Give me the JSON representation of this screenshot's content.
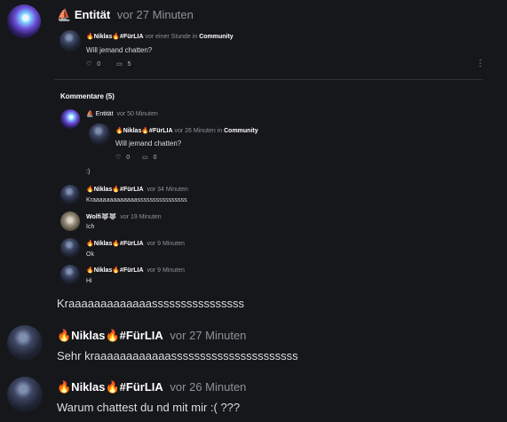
{
  "main_post": {
    "author": "Entität",
    "time": "vor 27 Minuten",
    "shared": {
      "author_prefix": "🔥Niklas🔥#FürLIA",
      "meta": "vor einer Stunde in",
      "community": "Community",
      "text": "Will jemand chatten?",
      "likes": "0",
      "comments": "5"
    }
  },
  "comments_header": "Kommentare (5)",
  "comments": [
    {
      "author": "Entität",
      "time": "vor 50 Minuten",
      "quoted": {
        "author": "🔥Niklas🔥#FürLIA",
        "meta": "vor 26 Minuten in",
        "community": "Community",
        "text": "Will jemand chatten?",
        "likes": "0",
        "comments": "0"
      },
      "text": ":)"
    },
    {
      "author": "🔥Niklas🔥#FürLIA",
      "time": "vor 34 Minuten",
      "text": "Kraaaaaaaaaaaaassssssssssssssss"
    },
    {
      "author": "Wolfi🐺🐺",
      "time": "vor 19 Minuten",
      "text": "Ich"
    },
    {
      "author": "🔥Niklas🔥#FürLIA",
      "time": "vor 9 Minuten",
      "text": "Ok"
    },
    {
      "author": "🔥Niklas🔥#FürLIA",
      "time": "vor 9 Minuten",
      "text": "Hi"
    }
  ],
  "standalone_text": "Kraaaaaaaaaaaaassssssssssssssss",
  "posts": [
    {
      "author": "🔥Niklas🔥#FürLIA",
      "time": "vor 27 Minuten",
      "text": "Sehr kraaaaaaaaaaaassssssssssssssssssssss"
    },
    {
      "author": "🔥Niklas🔥#FürLIA",
      "time": "vor 26 Minuten",
      "text": "Warum chattest du nd mit mir :( ???"
    }
  ],
  "colors": {
    "background": "#16171b",
    "text": "#dcddde",
    "muted": "#8e9297"
  },
  "icons": [
    "heart-icon",
    "comment-icon",
    "more-options-icon",
    "boat-icon"
  ]
}
